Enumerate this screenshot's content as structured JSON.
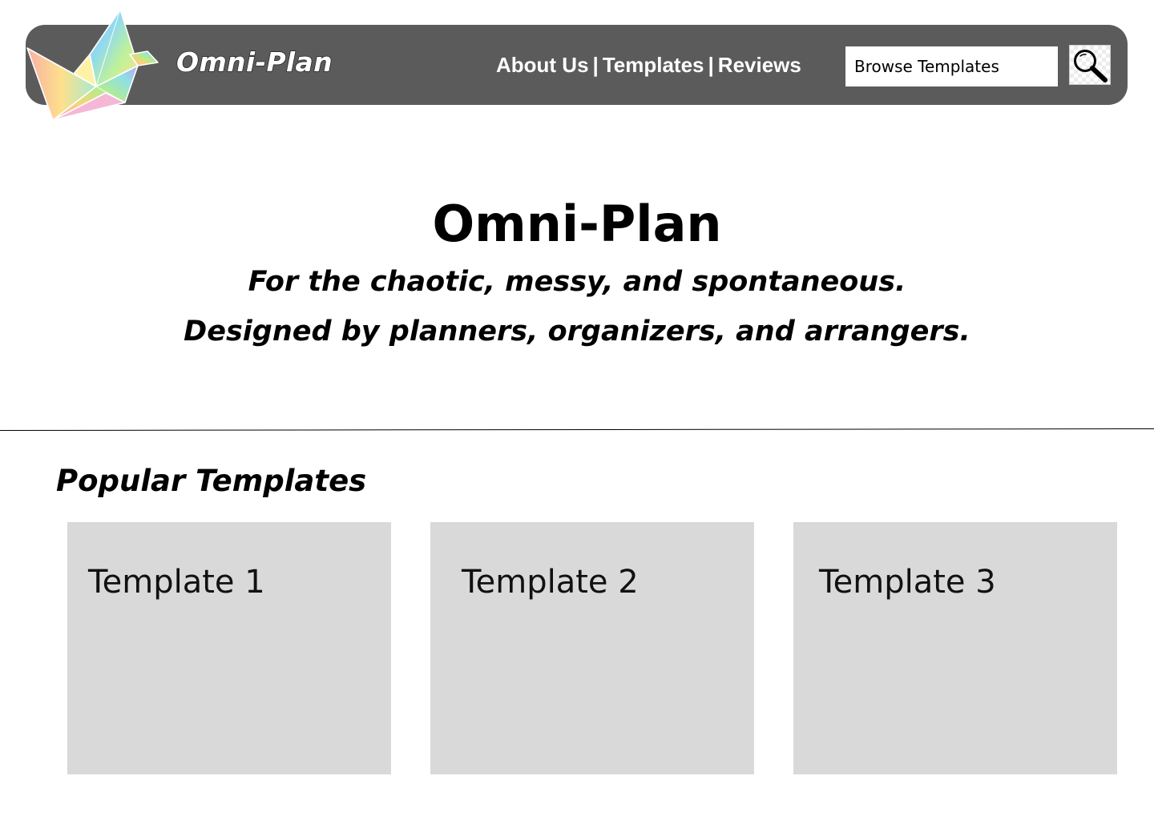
{
  "header": {
    "brand": "Omni-Plan",
    "logo": "origami-crane-logo",
    "nav": [
      {
        "label": "About Us"
      },
      {
        "label": "Templates"
      },
      {
        "label": "Reviews"
      }
    ],
    "nav_separator": "|",
    "search": {
      "placeholder": "Browse Templates",
      "icon": "magnifying-glass-icon"
    },
    "bar_color": "#5b5b5b"
  },
  "hero": {
    "title": "Omni-Plan",
    "tagline_1": "For the chaotic, messy, and spontaneous.",
    "tagline_2": "Designed by planners, organizers, and arrangers."
  },
  "popular": {
    "title": "Popular Templates",
    "cards": [
      {
        "label": "Template 1"
      },
      {
        "label": "Template 2"
      },
      {
        "label": "Template 3"
      }
    ],
    "card_color": "#d9d9d9"
  }
}
